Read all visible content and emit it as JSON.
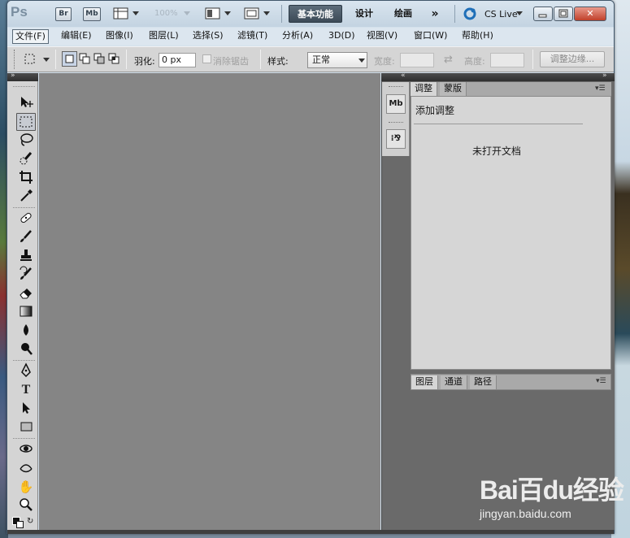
{
  "app": {
    "logo": "Ps"
  },
  "appbar": {
    "bridge": "Br",
    "minibridge": "Mb",
    "zoom": "100%",
    "workspaces": [
      "基本功能",
      "设计",
      "绘画"
    ],
    "more": "»",
    "cslive": "CS Live"
  },
  "window_controls": {
    "minimize": "▭",
    "restore": "▭",
    "close": "✕"
  },
  "menu": [
    "文件(F)",
    "编辑(E)",
    "图像(I)",
    "图层(L)",
    "选择(S)",
    "滤镜(T)",
    "分析(A)",
    "3D(D)",
    "视图(V)",
    "窗口(W)",
    "帮助(H)"
  ],
  "options": {
    "feather_label": "羽化:",
    "feather_value": "0 px",
    "antialias_label": "消除锯齿",
    "style_label": "样式:",
    "style_value": "正常",
    "width_label": "宽度:",
    "height_label": "高度:",
    "swap_glyph": "⇄",
    "refine_edge": "调整边缘..."
  },
  "adjust_panel": {
    "tabs": [
      "调整",
      "蒙版"
    ],
    "heading": "添加调整",
    "empty_msg": "未打开文档"
  },
  "layers_panel": {
    "tabs": [
      "图层",
      "通道",
      "路径"
    ]
  },
  "dock_icons": {
    "mb": "Mb",
    "adjust": "⁞⅋"
  },
  "collapse": {
    "left": "»",
    "right": "«",
    "right2": "»"
  },
  "watermark": {
    "brand": "Bai百du经验",
    "url": "jingyan.baidu.com"
  },
  "colors": {
    "accent": "#3c4a57",
    "canvas": "#858585",
    "panel": "#d6d6d6"
  }
}
